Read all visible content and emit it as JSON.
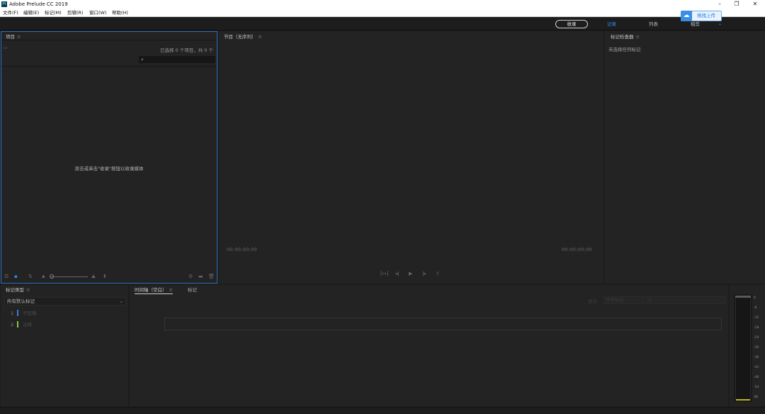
{
  "window": {
    "app_icon": "Pl",
    "title": "Adobe Prelude CC 2019",
    "controls": {
      "minimize": "–",
      "restore": "❐",
      "close": "✕"
    }
  },
  "menu": [
    "文件(F)",
    "编辑(E)",
    "标记(M)",
    "剪辑(R)",
    "窗口(W)",
    "帮助(H)"
  ],
  "workspace": {
    "ingest_label": "收录",
    "tabs": [
      "记录",
      "列表",
      "粗剪"
    ],
    "active_tab": "记录",
    "chevron": "⌄",
    "upload_badge": {
      "icon": "cloud-upload-icon",
      "label": "拖拽上传"
    },
    "accent_color": "#2d8ceb"
  },
  "project_panel": {
    "title": "项目",
    "menu_glyph": "≡",
    "selection_summary": "已选择 0 个项目，共 0 个",
    "search_placeholder": "",
    "empty_message": "双击或单击\"收录\"按钮以收录媒体"
  },
  "source_panel": {
    "title": "节目（无序列）",
    "menu_glyph": "≡",
    "timecode_in": "00;00;00;00",
    "timecode_out": "00;00;00;00"
  },
  "inspector_panel": {
    "title": "标记检查器",
    "menu_glyph": "≡",
    "empty_message": "未选择任何标记"
  },
  "marker_panel": {
    "title": "标记类型",
    "menu_glyph": "≡",
    "dropdown_value": "所有默认标记",
    "markers": [
      {
        "num": "1",
        "name": "子剪辑",
        "color": "#3a7bd5"
      },
      {
        "num": "2",
        "name": "注释",
        "color": "#8cc63f"
      }
    ]
  },
  "timeline_panel": {
    "tabs": [
      "时间轴（空白）",
      "标记"
    ],
    "menu_glyph": "≡",
    "show_label": "显示",
    "show_value": "所有标记"
  },
  "audio_meter": {
    "ticks": [
      "0",
      "-6",
      "-12",
      "-18",
      "-24",
      "-30",
      "-36",
      "-42",
      "-48",
      "-54",
      "dB"
    ]
  }
}
